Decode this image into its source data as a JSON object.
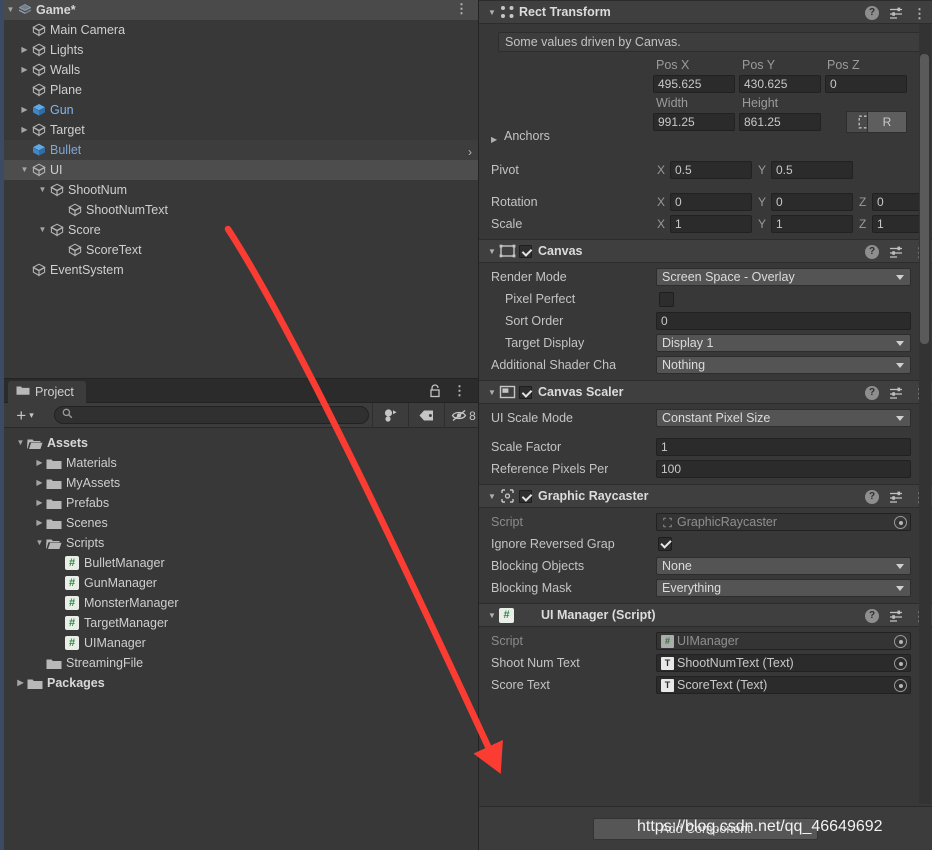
{
  "hierarchy": {
    "scene": {
      "label": "Game*",
      "icon": "unity-scene-icon",
      "menu_icon": "kebab-menu-icon"
    },
    "items": [
      {
        "label": "Main Camera",
        "depth": 1,
        "expandable": false,
        "type": "gameobject"
      },
      {
        "label": "Lights",
        "depth": 1,
        "expandable": true,
        "expanded": false,
        "type": "gameobject"
      },
      {
        "label": "Walls",
        "depth": 1,
        "expandable": true,
        "expanded": false,
        "type": "gameobject"
      },
      {
        "label": "Plane",
        "depth": 1,
        "expandable": false,
        "type": "gameobject"
      },
      {
        "label": "Gun",
        "depth": 1,
        "expandable": true,
        "expanded": false,
        "type": "prefab"
      },
      {
        "label": "Target",
        "depth": 1,
        "expandable": true,
        "expanded": false,
        "type": "gameobject"
      },
      {
        "label": "Bullet",
        "depth": 1,
        "expandable": false,
        "type": "prefab",
        "prefab_arrow": "›"
      },
      {
        "label": "UI",
        "depth": 1,
        "expandable": true,
        "expanded": true,
        "type": "gameobject",
        "selected": true
      },
      {
        "label": "ShootNum",
        "depth": 2,
        "expandable": true,
        "expanded": true,
        "type": "gameobject"
      },
      {
        "label": "ShootNumText",
        "depth": 3,
        "expandable": false,
        "type": "gameobject"
      },
      {
        "label": "Score",
        "depth": 2,
        "expandable": true,
        "expanded": true,
        "type": "gameobject"
      },
      {
        "label": "ScoreText",
        "depth": 3,
        "expandable": false,
        "type": "gameobject"
      },
      {
        "label": "EventSystem",
        "depth": 1,
        "expandable": false,
        "type": "gameobject"
      }
    ]
  },
  "project": {
    "tab_label": "Project",
    "tab_icon": "folder-icon",
    "lock_icon": "lock-icon",
    "menu_icon": "kebab-menu-icon",
    "toolbar": {
      "create_label": "+",
      "create_caret": "▾",
      "search_placeholder": "",
      "search_value": "",
      "search_icon": "magnifier-icon",
      "type_filter_icon": "search-by-type-icon",
      "label_filter_icon": "tag-icon",
      "visibility_icon": "eye-slash-icon",
      "visibility_count": "8"
    },
    "tree": [
      {
        "label": "Assets",
        "depth": 0,
        "expandable": true,
        "expanded": true,
        "type": "folder",
        "bold": true
      },
      {
        "label": "Materials",
        "depth": 1,
        "expandable": true,
        "expanded": false,
        "type": "folder"
      },
      {
        "label": "MyAssets",
        "depth": 1,
        "expandable": true,
        "expanded": false,
        "type": "folder"
      },
      {
        "label": "Prefabs",
        "depth": 1,
        "expandable": true,
        "expanded": false,
        "type": "folder"
      },
      {
        "label": "Scenes",
        "depth": 1,
        "expandable": true,
        "expanded": false,
        "type": "folder"
      },
      {
        "label": "Scripts",
        "depth": 1,
        "expandable": true,
        "expanded": true,
        "type": "folder"
      },
      {
        "label": "BulletManager",
        "depth": 2,
        "expandable": false,
        "type": "script"
      },
      {
        "label": "GunManager",
        "depth": 2,
        "expandable": false,
        "type": "script"
      },
      {
        "label": "MonsterManager",
        "depth": 2,
        "expandable": false,
        "type": "script"
      },
      {
        "label": "TargetManager",
        "depth": 2,
        "expandable": false,
        "type": "script"
      },
      {
        "label": "UIManager",
        "depth": 2,
        "expandable": false,
        "type": "script"
      },
      {
        "label": "StreamingFile",
        "depth": 1,
        "expandable": false,
        "type": "folder"
      },
      {
        "label": "Packages",
        "depth": 0,
        "expandable": true,
        "expanded": false,
        "type": "folder",
        "bold": true
      }
    ]
  },
  "inspector": {
    "rect_transform": {
      "title": "Rect Transform",
      "icon": "rect-transform-icon",
      "help_icon": "help-icon",
      "preset_icon": "preset-icon",
      "menu_icon": "kebab-menu-icon",
      "driven_note": "Some values driven by Canvas.",
      "col_pos_x": "Pos X",
      "col_pos_y": "Pos Y",
      "col_pos_z": "Pos Z",
      "pos_x": "495.625",
      "pos_y": "430.625",
      "pos_z": "0",
      "col_width": "Width",
      "col_height": "Height",
      "width": "991.25",
      "height": "861.25",
      "blueprint_btn": "blueprint-mode-icon",
      "raw_btn": "R",
      "anchors_label": "Anchors",
      "pivot_label": "Pivot",
      "pivot_x_axis": "X",
      "pivot_x": "0.5",
      "pivot_y_axis": "Y",
      "pivot_y": "0.5",
      "rotation_label": "Rotation",
      "rot_x_axis": "X",
      "rot_x": "0",
      "rot_y_axis": "Y",
      "rot_y": "0",
      "rot_z_axis": "Z",
      "rot_z": "0",
      "scale_label": "Scale",
      "scale_x_axis": "X",
      "scale_x": "1",
      "scale_y_axis": "Y",
      "scale_y": "1",
      "scale_z_axis": "Z",
      "scale_z": "1"
    },
    "canvas": {
      "title": "Canvas",
      "icon": "canvas-icon",
      "enabled": true,
      "render_mode_label": "Render Mode",
      "render_mode_value": "Screen Space - Overlay",
      "pixel_perfect_label": "Pixel Perfect",
      "pixel_perfect_checked": false,
      "sort_order_label": "Sort Order",
      "sort_order_value": "0",
      "target_display_label": "Target Display",
      "target_display_value": "Display 1",
      "shader_channels_label": "Additional Shader Cha",
      "shader_channels_value": "Nothing"
    },
    "canvas_scaler": {
      "title": "Canvas Scaler",
      "icon": "canvas-scaler-icon",
      "enabled": true,
      "ui_scale_mode_label": "UI Scale Mode",
      "ui_scale_mode_value": "Constant Pixel Size",
      "scale_factor_label": "Scale Factor",
      "scale_factor_value": "1",
      "ref_ppu_label": "Reference Pixels Per",
      "ref_ppu_value": "100"
    },
    "graphic_raycaster": {
      "title": "Graphic Raycaster",
      "icon": "graphic-raycaster-icon",
      "enabled": true,
      "script_label": "Script",
      "script_value": "GraphicRaycaster",
      "ignore_label": "Ignore Reversed Grap",
      "ignore_checked": true,
      "blocking_objects_label": "Blocking Objects",
      "blocking_objects_value": "None",
      "blocking_mask_label": "Blocking Mask",
      "blocking_mask_value": "Everything"
    },
    "ui_manager": {
      "title": "UI Manager (Script)",
      "icon": "csharp-script-icon",
      "script_label": "Script",
      "script_value": "UIManager",
      "shoot_num_text_label": "Shoot Num Text",
      "shoot_num_text_value": "ShootNumText (Text)",
      "score_text_label": "Score Text",
      "score_text_value": "ScoreText (Text)"
    },
    "add_component_label": "Add Component"
  },
  "annotation": {
    "arrow_color": "#fa3c32",
    "watermark_text": "https://blog.csdn.net/qq_46649692"
  }
}
